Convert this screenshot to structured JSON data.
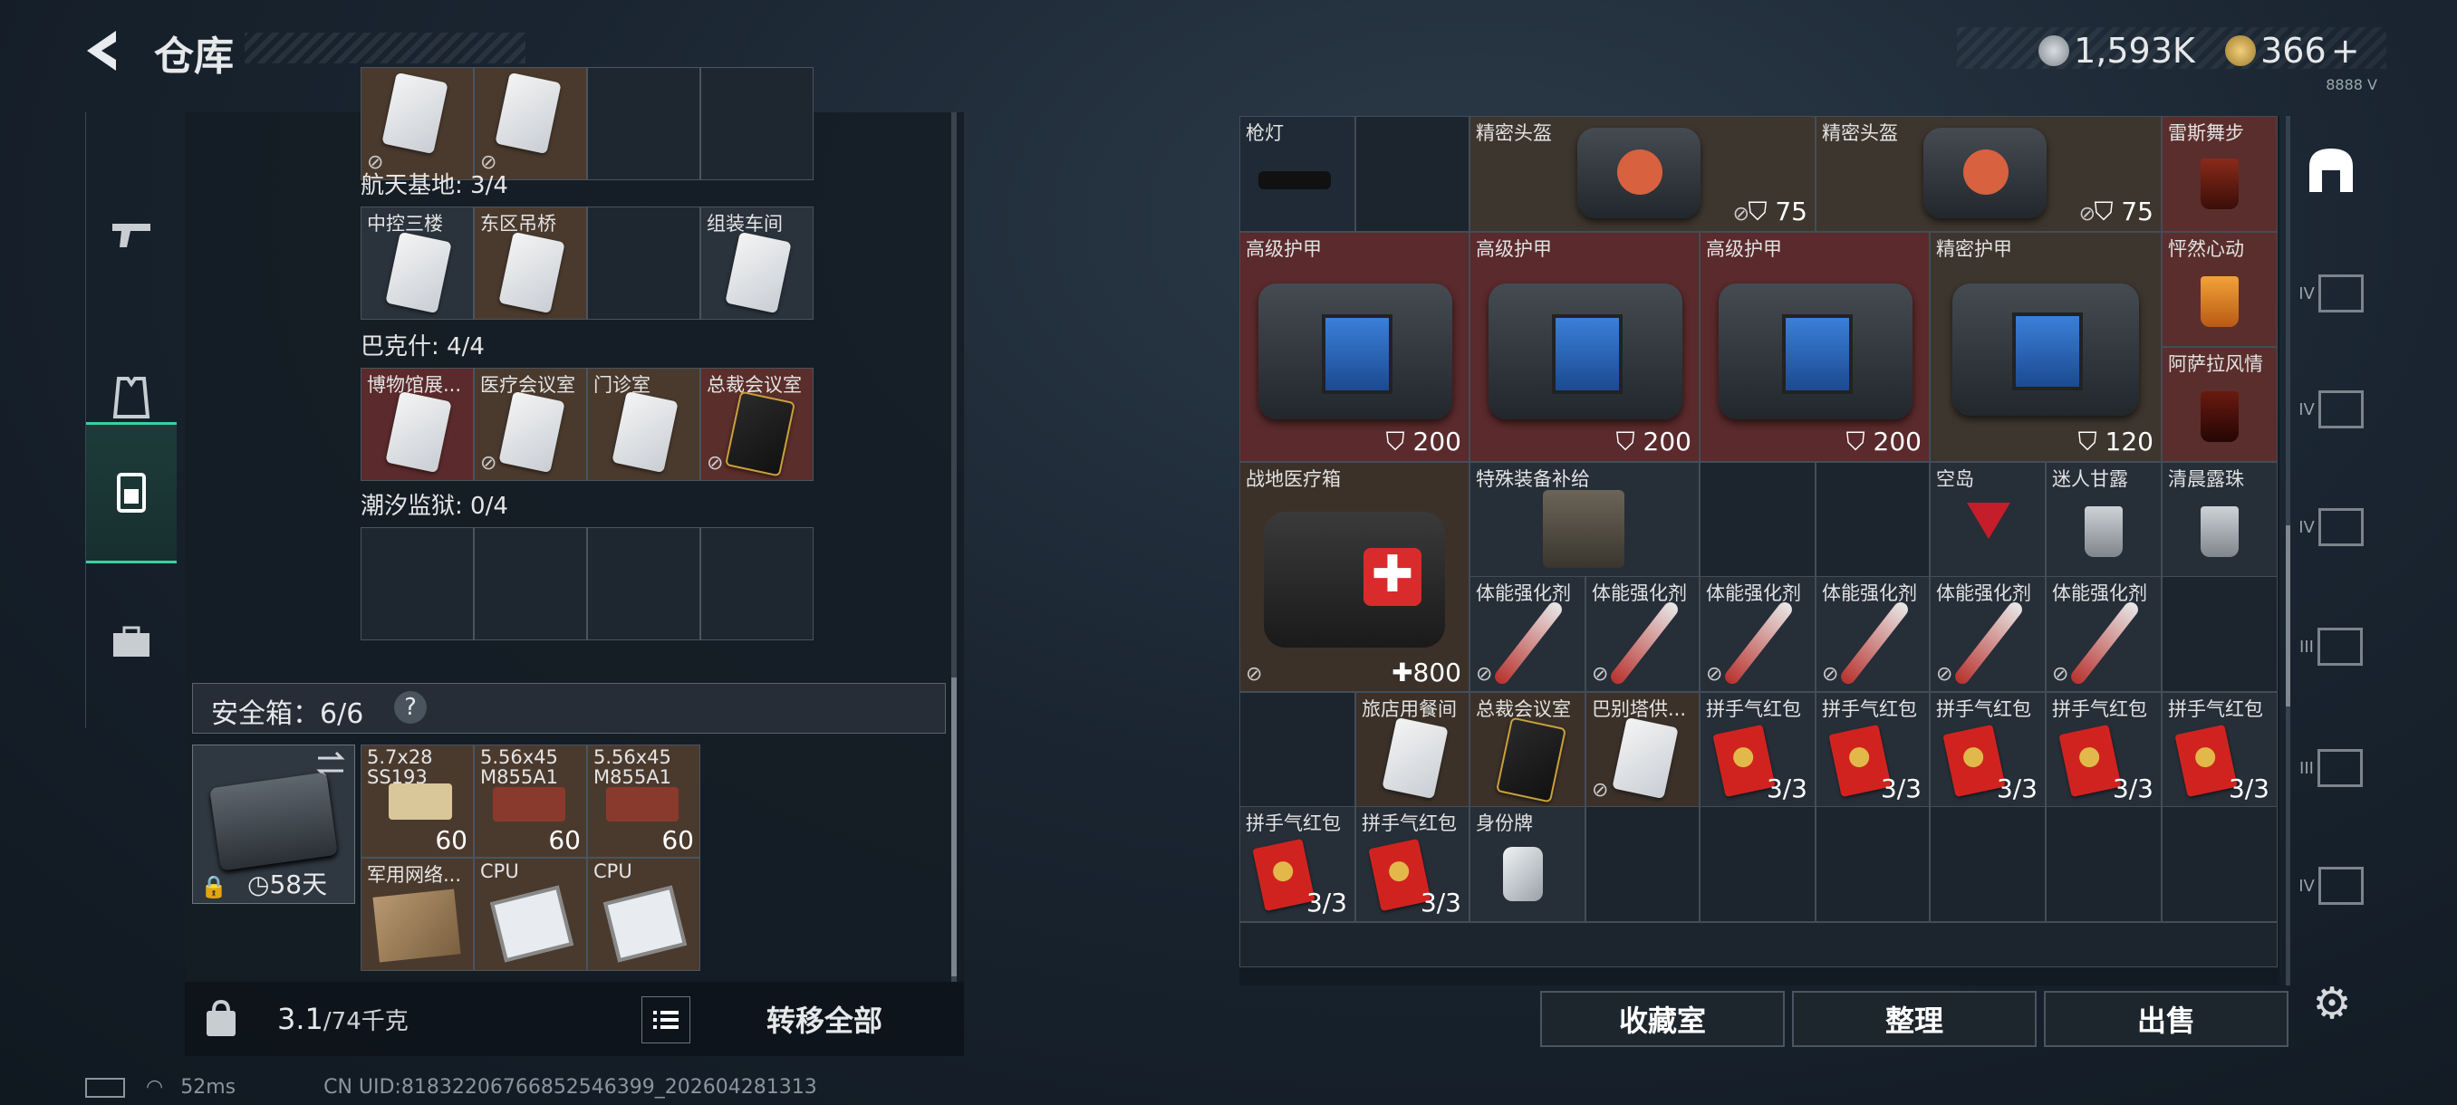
{
  "header": {
    "title": "仓库",
    "currency_1": "1,593K",
    "currency_2": "366",
    "currency_2_plus": "+",
    "build_tag": "8888 V"
  },
  "left_panel": {
    "sections": [
      {
        "name": "航天基地: 3/4",
        "cells": [
          "中控三楼",
          "东区吊桥",
          "",
          "组装车间"
        ]
      },
      {
        "name": "巴克什: 4/4",
        "cells": [
          "博物馆展...",
          "医疗会议室",
          "门诊室",
          "总裁会议室"
        ]
      },
      {
        "name": "潮汐监狱: 0/4",
        "cells": [
          "",
          "",
          "",
          ""
        ]
      }
    ],
    "safe_box": {
      "title": "安全箱：6/6",
      "help": "?",
      "timer": "58天",
      "items": [
        {
          "label": "5.7x28\nSS193",
          "count": "60"
        },
        {
          "label": "5.56x45\nM855A1",
          "count": "60"
        },
        {
          "label": "5.56x45\nM855A1",
          "count": "60"
        },
        {
          "label": "军用网络...",
          "count": ""
        },
        {
          "label": "CPU",
          "count": ""
        },
        {
          "label": "CPU",
          "count": ""
        }
      ]
    },
    "weight": "3.1",
    "weight_max": "/74千克",
    "transfer_all": "转移全部"
  },
  "right_panel": {
    "items": {
      "gun_light": "枪灯",
      "precision_helmet_1": "精密头盔",
      "helmet_dur_1": "75",
      "precision_helmet_2": "精密头盔",
      "helmet_dur_2": "75",
      "drink_1": "雷斯舞步",
      "armor_1": "高级护甲",
      "armor_dur_1": "200",
      "armor_2": "高级护甲",
      "armor_dur_2": "200",
      "armor_3": "高级护甲",
      "armor_dur_3": "200",
      "armor_4": "精密护甲",
      "armor_dur_4": "120",
      "drink_2": "怦然心动",
      "drink_3": "阿萨拉风情",
      "medkit": "战地医疗箱",
      "medkit_val": "800",
      "supply_box": "特殊装备补给",
      "drink_4": "空岛",
      "drink_5": "迷人甘露",
      "drink_6": "清晨露珠",
      "stim": [
        "体能强化剂",
        "体能强化剂",
        "体能强化剂",
        "体能强化剂",
        "体能强化剂",
        "体能强化剂"
      ],
      "card_1": "旅店用餐间",
      "card_2": "总裁会议室",
      "card_3": "巴别塔供...",
      "red_packets": [
        {
          "label": "拼手气红包",
          "count": "3/3"
        },
        {
          "label": "拼手气红包",
          "count": "3/3"
        },
        {
          "label": "拼手气红包",
          "count": "3/3"
        },
        {
          "label": "拼手气红包",
          "count": "3/3"
        },
        {
          "label": "拼手气红包",
          "count": "3/3"
        },
        {
          "label": "拼手气红包",
          "count": "3/3"
        },
        {
          "label": "拼手气红包",
          "count": "3/3"
        }
      ],
      "dog_tag": "身份牌"
    },
    "buttons": {
      "collection": "收藏室",
      "organize": "整理",
      "sell": "出售"
    },
    "side_tabs": [
      "IV",
      "IV",
      "IV",
      "III",
      "III",
      "IV"
    ]
  },
  "status": {
    "ping": "52ms",
    "uid": "CN UID:8183220676685254639​9_202604281313"
  }
}
